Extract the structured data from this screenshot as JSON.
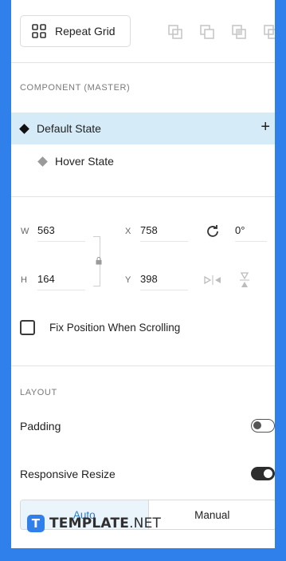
{
  "toolbar": {
    "repeat_grid_label": "Repeat Grid",
    "boolean_icons": [
      "add-icon",
      "subtract-icon",
      "intersect-icon",
      "exclude-icon"
    ]
  },
  "component": {
    "section_title": "COMPONENT (MASTER)",
    "states": [
      {
        "label": "Default State",
        "selected": true,
        "marker": "filled-diamond-icon"
      },
      {
        "label": "Hover State",
        "selected": false,
        "marker": "outline-diamond-icon"
      }
    ],
    "add_state_symbol": "+"
  },
  "transform": {
    "w_label": "W",
    "w_value": "563",
    "x_label": "X",
    "x_value": "758",
    "h_label": "H",
    "h_value": "164",
    "y_label": "Y",
    "y_value": "398",
    "rotation_value": "0°"
  },
  "fix_position": {
    "label": "Fix Position When Scrolling",
    "checked": false
  },
  "layout": {
    "section_title": "LAYOUT",
    "padding_label": "Padding",
    "padding_enabled": false,
    "responsive_label": "Responsive Resize",
    "responsive_enabled": true,
    "segments": [
      "Auto",
      "Manual"
    ],
    "selected_segment": "Auto"
  },
  "watermark": {
    "badge_letter": "T",
    "brand": "TEMPLATE",
    "suffix": ".NET"
  },
  "colors": {
    "frame_blue": "#2f80ea",
    "selection_bg": "#d6ebf8",
    "accent": "#2b7bd3"
  }
}
